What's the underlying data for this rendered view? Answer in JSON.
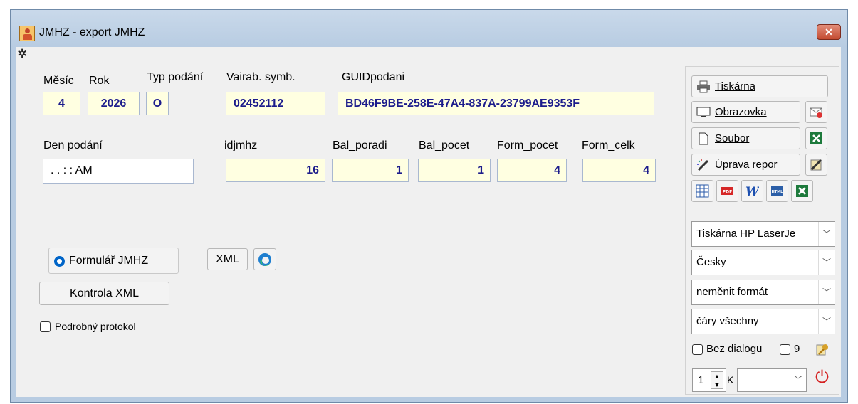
{
  "window": {
    "title": "JMHZ - export JMHZ",
    "close_label": "✕"
  },
  "labels": {
    "mesic": "Měsíc",
    "rok": "Rok",
    "typ_podani": "Typ podání",
    "vairab_symb": "Vairab. symb.",
    "guid": "GUIDpodani",
    "den_podani": "Den podání",
    "idjmhz": "idjmhz",
    "bal_poradi": "Bal_poradi",
    "bal_pocet": "Bal_pocet",
    "form_pocet": "Form_pocet",
    "form_celk": "Form_celk"
  },
  "fields": {
    "mesic": "4",
    "rok": "2026",
    "typ_podani": "O",
    "vairab_symb": "02452112",
    "guid": "BD46F9BE-258E-47A4-837A-23799AE9353F",
    "den_podani": " .  .     : :  AM",
    "idjmhz": "16",
    "bal_poradi": "1",
    "bal_pocet": "1",
    "form_pocet": "4",
    "form_celk": "4"
  },
  "actions": {
    "formular_label": "Formulář JMHZ",
    "formular_selected": true,
    "xml_label": "XML",
    "kontrola_label": "Kontrola XML",
    "podrobny_label": "Podrobný protokol",
    "podrobny_checked": false
  },
  "print_panel": {
    "tiskarna": "Tiskárna",
    "obrazovka": "Obrazovka",
    "soubor": "Soubor",
    "uprava": "Úprava repor",
    "printer_select": "Tiskárna HP LaserJe",
    "language_select": "Česky",
    "format_select": "neměnit formát",
    "lines_select": "čáry všechny",
    "bez_dialogu": "Bez dialogu",
    "bez_dialogu_checked": false,
    "nine_label": "9",
    "nine_checked": false,
    "copies": "1",
    "copies_suffix": "K",
    "extra_select": ""
  },
  "colors": {
    "field_bg": "#ffffe1",
    "field_text": "#1c1c8c",
    "radio_accent": "#0065c8",
    "power": "#d42020",
    "excel": "#1d7a3c"
  }
}
